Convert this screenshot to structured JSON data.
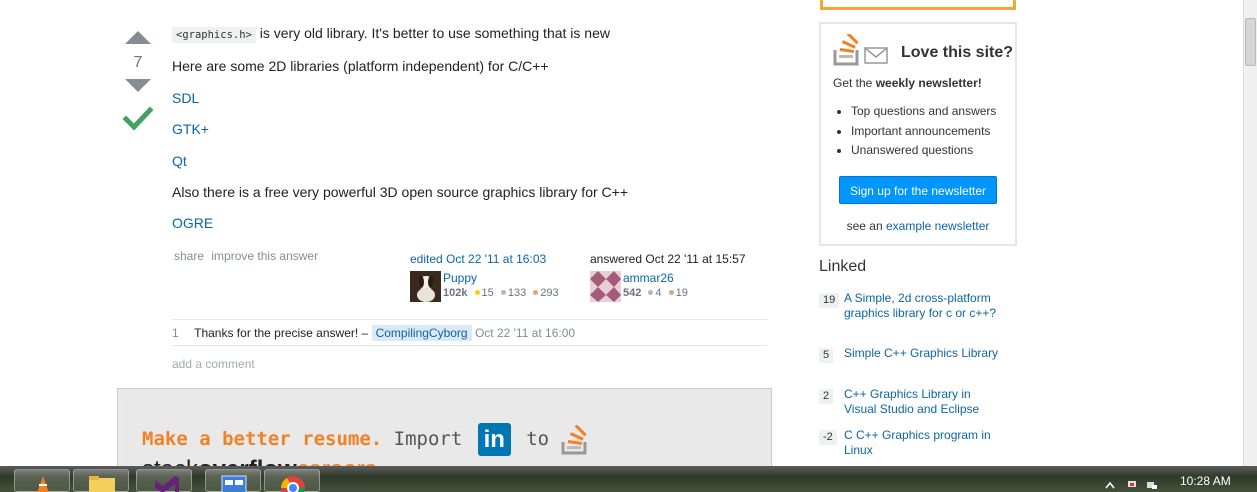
{
  "vote": {
    "count": "7",
    "accepted": true
  },
  "answer": {
    "code": "<graphics.h>",
    "intro": "is very old library. It's better to use something that is new",
    "line2": "Here are some 2D libraries (platform independent) for C/C++",
    "libs": [
      "SDL",
      "GTK+",
      "Qt"
    ],
    "line3": "Also there is a free very powerful 3D open source graphics library for C++",
    "lib3d": "OGRE"
  },
  "menu": {
    "share": "share",
    "improve": "improve this answer"
  },
  "edited": {
    "action": "edited Oct 22 '11 at 16:03",
    "user": "Puppy",
    "rep": "102k",
    "gold": "15",
    "silver": "133",
    "bronze": "293"
  },
  "answered": {
    "action": "answered Oct 22 '11 at 15:57",
    "user": "ammar26",
    "rep": "542",
    "silver": "4",
    "bronze": "19"
  },
  "comment": {
    "score": "1",
    "text": "Thanks for the precise answer! –",
    "user": "CompilingCyborg",
    "date": "Oct 22 '11 at 16:00"
  },
  "add_comment": "add a comment",
  "ad": {
    "lead": "Make a better resume.",
    "import": "Import",
    "in": "in",
    "to": "to",
    "brand_a": "stack",
    "brand_b": "overflow",
    "brand_c": "careers"
  },
  "newsletter": {
    "title": "Love this site?",
    "sub_pre": "Get the ",
    "sub_bold": "weekly newsletter!",
    "items": [
      "Top questions and answers",
      "Important announcements",
      "Unanswered questions"
    ],
    "button": "Sign up for the newsletter",
    "see_pre": "see an ",
    "see_link": "example newsletter"
  },
  "linked": {
    "title": "Linked",
    "items": [
      {
        "count": "19",
        "text": "A Simple, 2d cross-platform graphics library for c or c++?"
      },
      {
        "count": "5",
        "text": "Simple C++ Graphics Library"
      },
      {
        "count": "2",
        "text": "C++ Graphics Library in Visual Studio and Eclipse"
      },
      {
        "count": "-2",
        "text": "C C++ Graphics program in Linux"
      }
    ]
  },
  "taskbar": {
    "clock": "10:28 AM"
  },
  "colors": {
    "link": "#0c65a5",
    "accent": "#f48024",
    "button": "#0095ff",
    "accepted": "#45a163"
  }
}
